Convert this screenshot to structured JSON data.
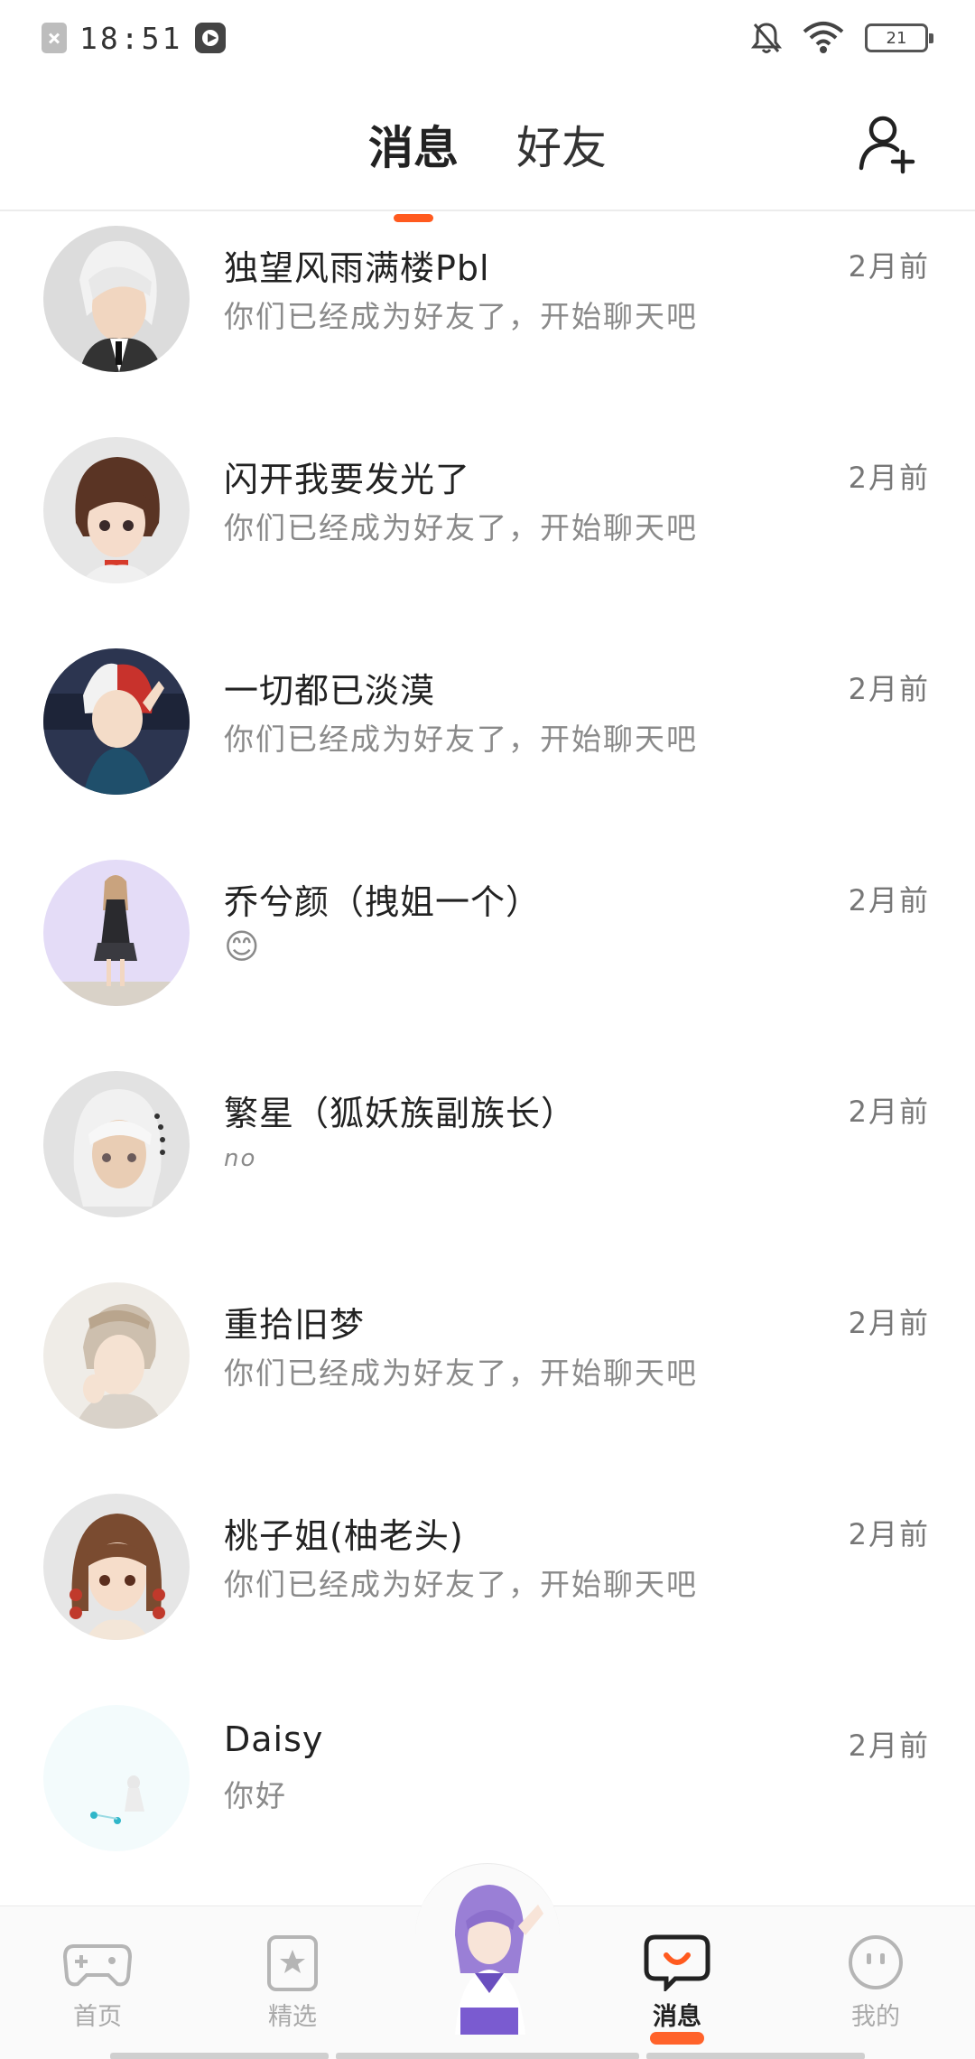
{
  "status_bar": {
    "time": "18:51",
    "battery": "21",
    "icons": [
      "close-notification-icon",
      "video-recording-icon",
      "mute-bell-icon",
      "wifi-icon",
      "battery-icon"
    ]
  },
  "header": {
    "tabs": [
      {
        "label": "消息",
        "active": true
      },
      {
        "label": "好友",
        "active": false
      }
    ],
    "add_friend_icon": "add-user-icon",
    "accent_color": "#ff5a1f"
  },
  "conversations": [
    {
      "name": "独望风雨满楼Pbl",
      "message": "你们已经成为好友了，开始聊天吧",
      "time": "2月前"
    },
    {
      "name": "闪开我要发光了",
      "message": "你们已经成为好友了，开始聊天吧",
      "time": "2月前"
    },
    {
      "name": "一切都已淡漠",
      "message": "你们已经成为好友了，开始聊天吧",
      "time": "2月前"
    },
    {
      "name": "乔兮颜（拽姐一个）",
      "message": "😊",
      "time": "2月前"
    },
    {
      "name": "繁星（狐妖族副族长）",
      "message": "no",
      "time": "2月前"
    },
    {
      "name": "重拾旧梦",
      "message": "你们已经成为好友了，开始聊天吧",
      "time": "2月前"
    },
    {
      "name": "桃子姐(柚老头)",
      "message": "你们已经成为好友了，开始聊天吧",
      "time": "2月前"
    },
    {
      "name": "Daisy",
      "message": "你好",
      "time": "2月前"
    }
  ],
  "bottom_nav": [
    {
      "label": "首页",
      "icon": "gamepad-icon",
      "active": false
    },
    {
      "label": "精选",
      "icon": "star-bookmark-icon",
      "active": false
    },
    {
      "label": "",
      "icon": "character-avatar",
      "active": false
    },
    {
      "label": "消息",
      "icon": "chat-bubble-icon",
      "active": true
    },
    {
      "label": "我的",
      "icon": "smiley-face-icon",
      "active": false
    }
  ]
}
